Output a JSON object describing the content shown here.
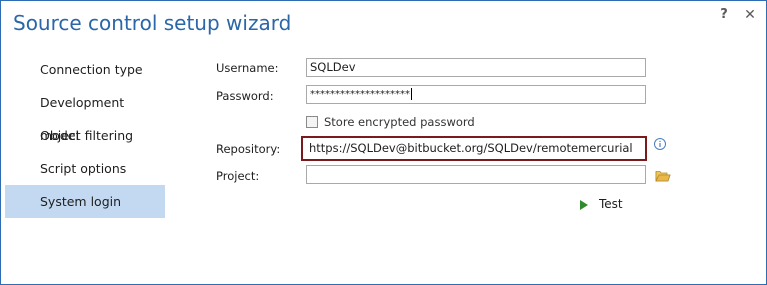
{
  "window": {
    "title": "Source control setup wizard",
    "help_label": "?",
    "close_label": "✕"
  },
  "sidebar": {
    "items": [
      {
        "label": "Connection type"
      },
      {
        "label": "Development model"
      },
      {
        "label": "Object filtering"
      },
      {
        "label": "Script options"
      },
      {
        "label": "System login"
      }
    ],
    "active_index": 4
  },
  "form": {
    "username_label": "Username:",
    "username_value": "SQLDev",
    "password_label": "Password:",
    "password_value": "********************",
    "store_encrypted_label": "Store encrypted password",
    "store_encrypted_checked": false,
    "repository_label": "Repository:",
    "repository_value": "https://SQLDev@bitbucket.org/SQLDev/remotemercurial",
    "project_label": "Project:",
    "project_value": "",
    "test_label": "Test"
  },
  "icons": {
    "info": "info-icon",
    "folder": "folder-icon",
    "test": "play-icon"
  },
  "colors": {
    "accent": "#2a66a8",
    "sidebar_active": "#c3d9f2",
    "repo_highlight": "#7b1a1a",
    "play_green": "#2e8b2e",
    "folder_yellow": "#e8b84a"
  }
}
